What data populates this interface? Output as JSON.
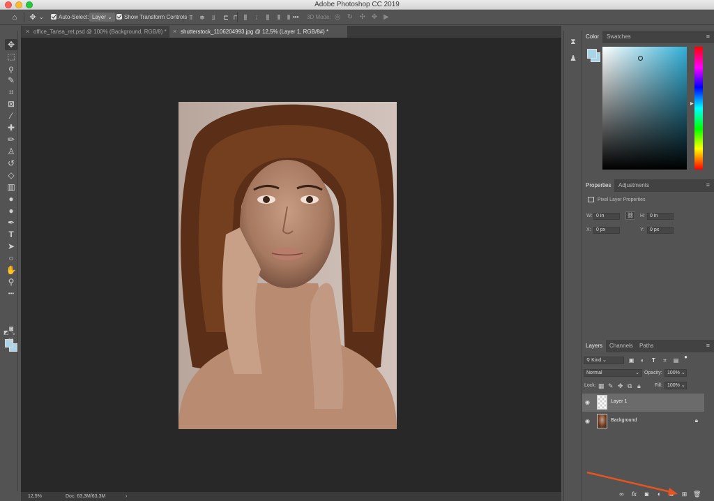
{
  "window": {
    "title": "Adobe Photoshop CC 2019"
  },
  "options_bar": {
    "auto_select_label": "Auto-Select:",
    "auto_select_value": "Layer",
    "show_transform_label": "Show Transform Controls",
    "mode_3d_label": "3D Mode:",
    "more_label": "•••"
  },
  "tabs": [
    {
      "label": "office_Tansa_ret.psd @ 100% (Background, RGB/8) *",
      "close": "×"
    },
    {
      "label": "shutterstock_1106204993.jpg @ 12,5% (Layer 1, RGB/8#) *",
      "close": "×"
    }
  ],
  "status": {
    "zoom": "12,5%",
    "doc": "Doc: 63,3M/63,3M",
    "arrow": "›"
  },
  "color_panel": {
    "tabs": [
      "Color",
      "Swatches"
    ],
    "foreground": "#a6d4e8",
    "background": "#a6d4e8",
    "hue": "#32b0d8"
  },
  "properties_panel": {
    "tabs": [
      "Properties",
      "Adjustments"
    ],
    "heading": "Pixel Layer Properties",
    "w_label": "W:",
    "w_value": "0 in",
    "h_label": "H:",
    "h_value": "0 in",
    "x_label": "X:",
    "x_value": "0 px",
    "y_label": "Y:",
    "y_value": "0 px"
  },
  "layers_panel": {
    "tabs": [
      "Layers",
      "Channels",
      "Paths"
    ],
    "filter_kind": "Kind",
    "blend_mode": "Normal",
    "opacity_label": "Opacity:",
    "opacity_value": "100%",
    "lock_label": "Lock:",
    "fill_label": "Fill:",
    "fill_value": "100%",
    "layers": [
      {
        "name": "Layer 1",
        "selected": true,
        "locked": false
      },
      {
        "name": "Background",
        "selected": false,
        "locked": true
      }
    ]
  },
  "icons": {
    "home": "⌂",
    "move": "✥",
    "marquee": "⬚",
    "lasso": "ϙ",
    "quick-select": "✎",
    "crop": "⌗",
    "frame": "⊠",
    "eyedropper": "⁄",
    "healing": "✚",
    "brush": "✏",
    "stamp": "♙",
    "history-brush": "↺",
    "eraser": "◇",
    "gradient": "▥",
    "blur": "●",
    "dodge": "🔍",
    "pen": "✒",
    "type": "T",
    "path-select": "➤",
    "ellipse": "○",
    "hand": "✋",
    "zoom": "⚲",
    "more": "•••",
    "eye": "👁",
    "lock": "🔒",
    "link": "⛓",
    "fx": "fx",
    "mask": "◙",
    "adjust": "◐",
    "folder": "▰",
    "new-layer": "⊞",
    "trash": "🗑",
    "menu": "≡"
  }
}
